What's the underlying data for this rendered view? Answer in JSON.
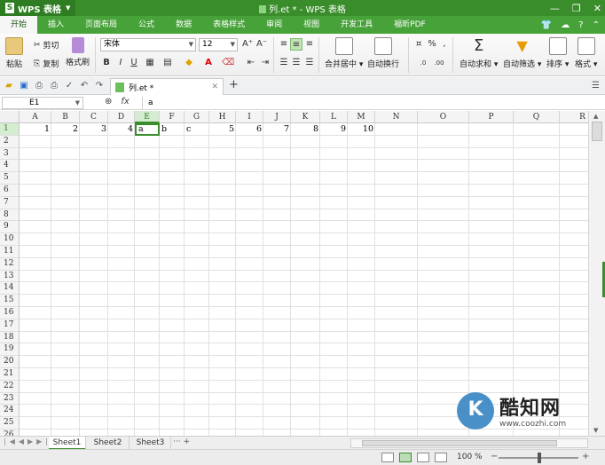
{
  "app": {
    "button_label": "WPS 表格",
    "logo_letter": "S",
    "window_title": "列.et * - WPS 表格"
  },
  "menu": {
    "tabs": [
      "开始",
      "插入",
      "页面布局",
      "公式",
      "数据",
      "表格样式",
      "审阅",
      "视图",
      "开发工具",
      "福昕PDF"
    ],
    "active_index": 0
  },
  "ribbon": {
    "paste": "粘贴",
    "cut": "剪切",
    "copy": "复制",
    "format_painter": "格式刷",
    "font_name": "宋体",
    "font_size": "12",
    "bold": "B",
    "italic": "I",
    "underline": "U",
    "merge_center": "合并居中",
    "wrap_text": "自动换行",
    "autosum": "自动求和",
    "autofilter": "自动筛选",
    "sort": "排序",
    "format": "格式"
  },
  "document_tab": {
    "label": "列.et *"
  },
  "formula_bar": {
    "name_box": "E1",
    "fx": "fx",
    "content": "a"
  },
  "grid": {
    "columns": [
      "A",
      "B",
      "C",
      "D",
      "E",
      "F",
      "G",
      "H",
      "I",
      "J",
      "K",
      "L",
      "M",
      "N",
      "O",
      "P",
      "Q",
      "R"
    ],
    "rows": [
      "1",
      "2",
      "3",
      "4",
      "5",
      "6",
      "7",
      "8",
      "9",
      "10",
      "11",
      "12",
      "13",
      "14",
      "15",
      "16",
      "17",
      "18",
      "19",
      "20",
      "21",
      "22",
      "23",
      "24",
      "25",
      "26"
    ],
    "selected_cell": "E1",
    "row1": {
      "A": "1",
      "B": "2",
      "C": "3",
      "D": "4",
      "E": "a",
      "F": "b",
      "G": "c",
      "H": "5",
      "I": "6",
      "J": "7",
      "K": "8",
      "L": "9",
      "M": "10"
    }
  },
  "sheets": {
    "tabs": [
      "Sheet1",
      "Sheet2",
      "Sheet3"
    ],
    "active_index": 0
  },
  "status": {
    "zoom": "100 %"
  },
  "watermark": {
    "logo_letter": "K",
    "name": "酷知网",
    "url": "www.coozhi.com"
  },
  "colors": {
    "accent": "#3a8d2b",
    "menubar": "#48a23a"
  }
}
